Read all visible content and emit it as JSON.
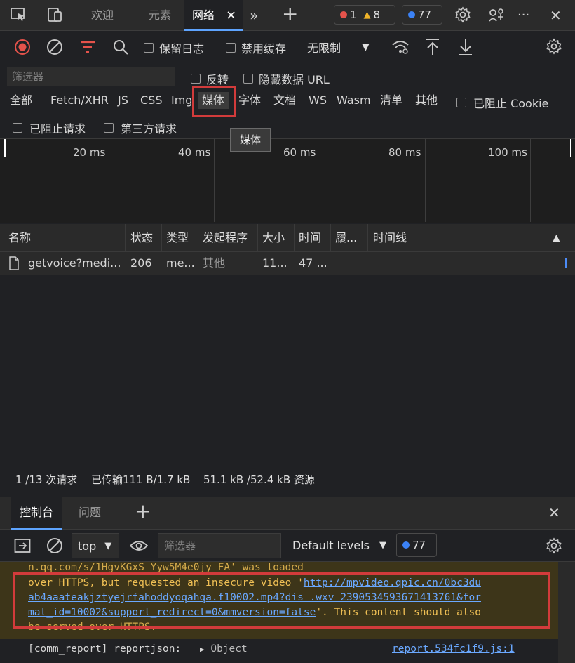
{
  "topbar": {
    "tabs": [
      "欢迎",
      "元素",
      "网络"
    ],
    "active_tab_close": "×",
    "more": "»",
    "add": "+",
    "errors": "1",
    "warnings": "8",
    "messages": "77",
    "menu": "···",
    "close": "✕"
  },
  "toolbar": {
    "preserve_log": "保留日志",
    "disable_cache": "禁用缓存",
    "throttling": "无限制"
  },
  "filters": {
    "placeholder": "筛选器",
    "invert": "反转",
    "hide_data_urls": "隐藏数据 URL",
    "types": [
      "全部",
      "Fetch/XHR",
      "JS",
      "CSS",
      "Img",
      "媒体",
      "字体",
      "文档",
      "WS",
      "Wasm",
      "清单",
      "其他"
    ],
    "blocked_cookies": "已阻止 Cookie",
    "blocked_requests": "已阻止请求",
    "third_party": "第三方请求",
    "tooltip": "媒体"
  },
  "overview": {
    "ticks": [
      "20 ms",
      "40 ms",
      "60 ms",
      "80 ms",
      "100 ms"
    ]
  },
  "table": {
    "headers": [
      "名称",
      "状态",
      "类型",
      "发起程序",
      "大小",
      "时间",
      "履...",
      "时间线"
    ],
    "rows": [
      {
        "name": "getvoice?medi...",
        "status": "206",
        "type": "me...",
        "initiator": "其他",
        "size": "11...",
        "time": "47 ..."
      }
    ]
  },
  "summary": {
    "requests": "1 /13 次请求",
    "transferred": "已传输111 B/1.7 kB",
    "resources": "51.1 kB /52.4 kB 资源"
  },
  "drawer": {
    "tabs": [
      "控制台",
      "问题"
    ],
    "add": "+",
    "close": "✕"
  },
  "console": {
    "context": "top",
    "filter_placeholder": "筛选器",
    "levels": "Default levels",
    "msg_count": "77",
    "warning": {
      "line0": "n.qq.com/s/1HgvKGxS_Yyw5M4e0jy_FA' was loaded",
      "line1_pre": "over HTTPS, but requested an insecure video '",
      "link1": "http://mpvideo.qpic.cn/0bc3du",
      "link2": "ab4aaateakjztyejrfahoddyoqahqa.f10002.mp4?dis_.wxv_2390534593671413761&for",
      "link3": "mat_id=10002&support_redirect=0&mmversion=false",
      "line3_post": "'. This content should also",
      "line4": "be served over HTTPS."
    },
    "log": {
      "label": "[comm_report] reportjson:",
      "object": "Object",
      "source": "report.534fc1f9.js:1"
    }
  },
  "colors": {
    "accent": "#5ea4ff",
    "error": "#e5534b",
    "warning": "#f0b429",
    "highlight": "#d23b3b",
    "warning_bg": "#3d3519"
  }
}
